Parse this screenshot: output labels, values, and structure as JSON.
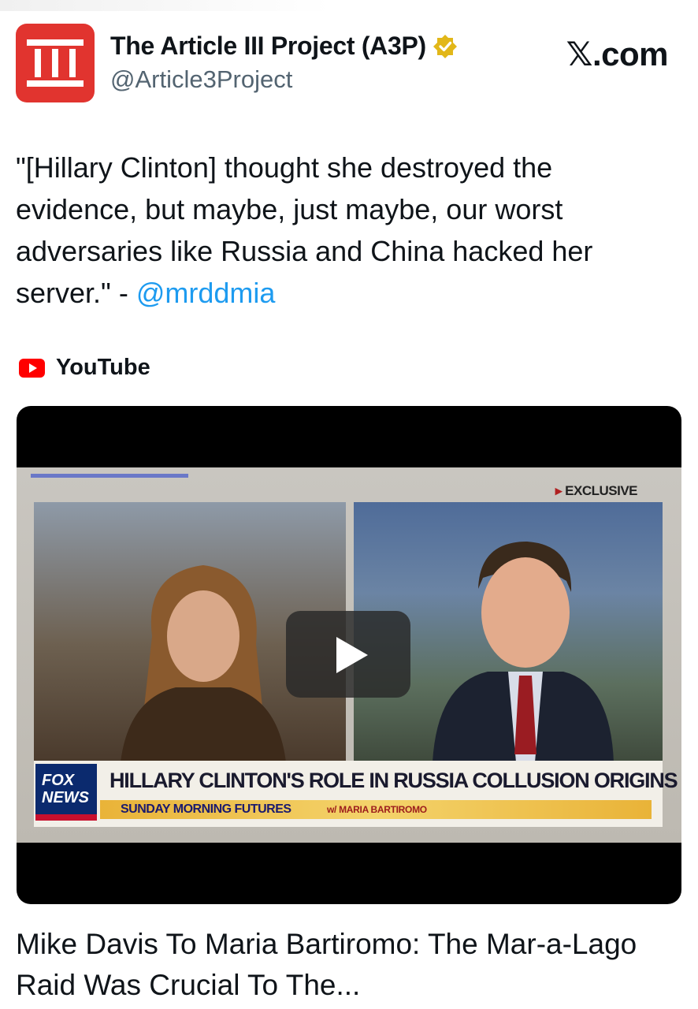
{
  "account": {
    "display_name": "The Article III Project (A3P)",
    "handle": "@Article3Project",
    "verified_badge_color": "#e2b719",
    "avatar_color": "#e1342f",
    "avatar_icon": "roman-numeral-three-icon"
  },
  "site": {
    "x_glyph": "𝕏",
    "domain": ".com"
  },
  "tweet": {
    "text_before_mention": "\"[Hillary Clinton] thought she destroyed the evidence, but maybe, just maybe, our worst adversaries like Russia and China hacked her server.\" - ",
    "mention": "@mrddmia",
    "mention_color": "#1d9bf0"
  },
  "card": {
    "source_icon": "youtube-icon",
    "source_label": "YouTube",
    "play_icon": "play-icon",
    "thumbnail": {
      "exclusive_tag": "EXCLUSIVE",
      "network_logo_line1": "FOX",
      "network_logo_line2": "NEWS",
      "headline": "HILLARY CLINTON'S ROLE IN RUSSIA COLLUSION ORIGINS",
      "show_name": "SUNDAY MORNING FUTURES",
      "host": "w/ MARIA BARTIROMO"
    },
    "title": "Mike Davis To Maria Bartiromo: The Mar-a-Lago Raid Was Crucial To The..."
  }
}
